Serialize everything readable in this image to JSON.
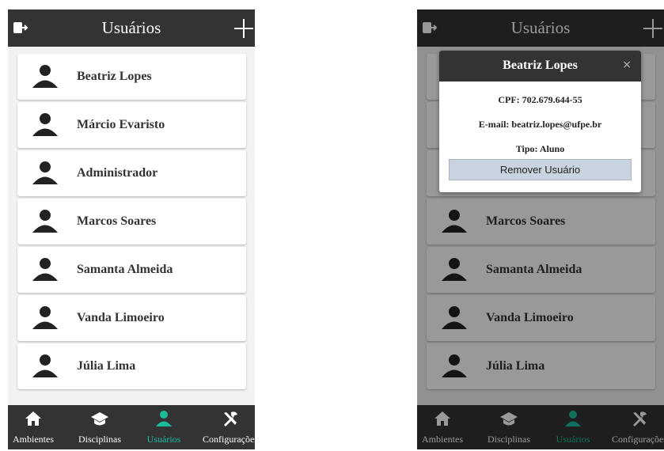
{
  "header": {
    "title": "Usuários"
  },
  "users": [
    {
      "name": "Beatriz Lopes"
    },
    {
      "name": "Márcio Evaristo"
    },
    {
      "name": "Administrador"
    },
    {
      "name": "Marcos Soares"
    },
    {
      "name": "Samanta Almeida"
    },
    {
      "name": "Vanda Limoeiro"
    },
    {
      "name": "Júlia Lima"
    }
  ],
  "nav": [
    {
      "label": "Ambientes",
      "icon": "home-icon"
    },
    {
      "label": "Disciplinas",
      "icon": "graduation-cap-icon"
    },
    {
      "label": "Usuários",
      "icon": "user-icon",
      "active": true
    },
    {
      "label": "Configurações",
      "icon": "tools-icon"
    }
  ],
  "modal": {
    "title": "Beatriz Lopes",
    "close": "×",
    "cpf": "CPF: 702.679.644-55",
    "email": "E-mail: beatriz.lopes@ufpe.br",
    "tipo": "Tipo: Aluno",
    "remove_label": "Remover Usuário"
  },
  "colors": {
    "bar": "#333333",
    "accent": "#1abc9c",
    "button": "#c9d4e0"
  }
}
